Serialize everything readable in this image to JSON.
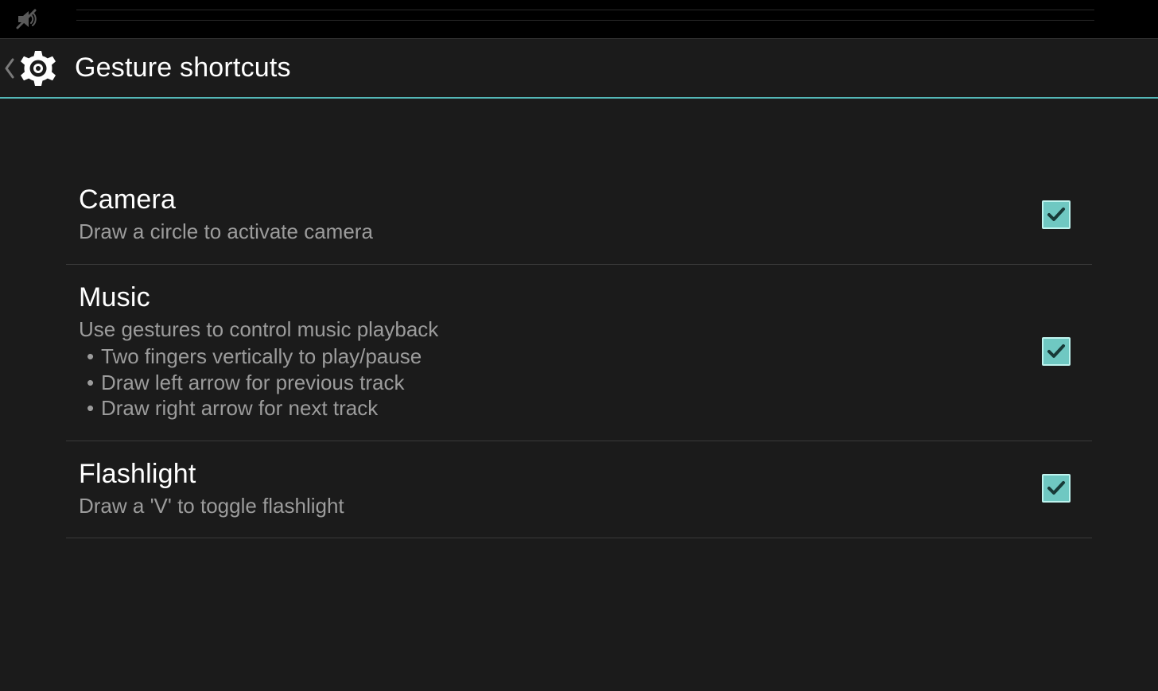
{
  "header": {
    "title": "Gesture shortcuts"
  },
  "items": [
    {
      "title": "Camera",
      "desc": "Draw a circle to activate camera",
      "bullets": [],
      "checked": true
    },
    {
      "title": "Music",
      "desc": "Use gestures to control music playback",
      "bullets": [
        "Two fingers vertically to play/pause",
        "Draw left arrow for previous track",
        "Draw right arrow for next track"
      ],
      "checked": true
    },
    {
      "title": "Flashlight",
      "desc": "Draw a 'V' to toggle flashlight",
      "bullets": [],
      "checked": true
    }
  ],
  "colors": {
    "accent": "#6fc8c2",
    "accentLine": "#54b8b8",
    "bg": "#1b1b1b",
    "secondaryText": "#9c9c9c"
  }
}
